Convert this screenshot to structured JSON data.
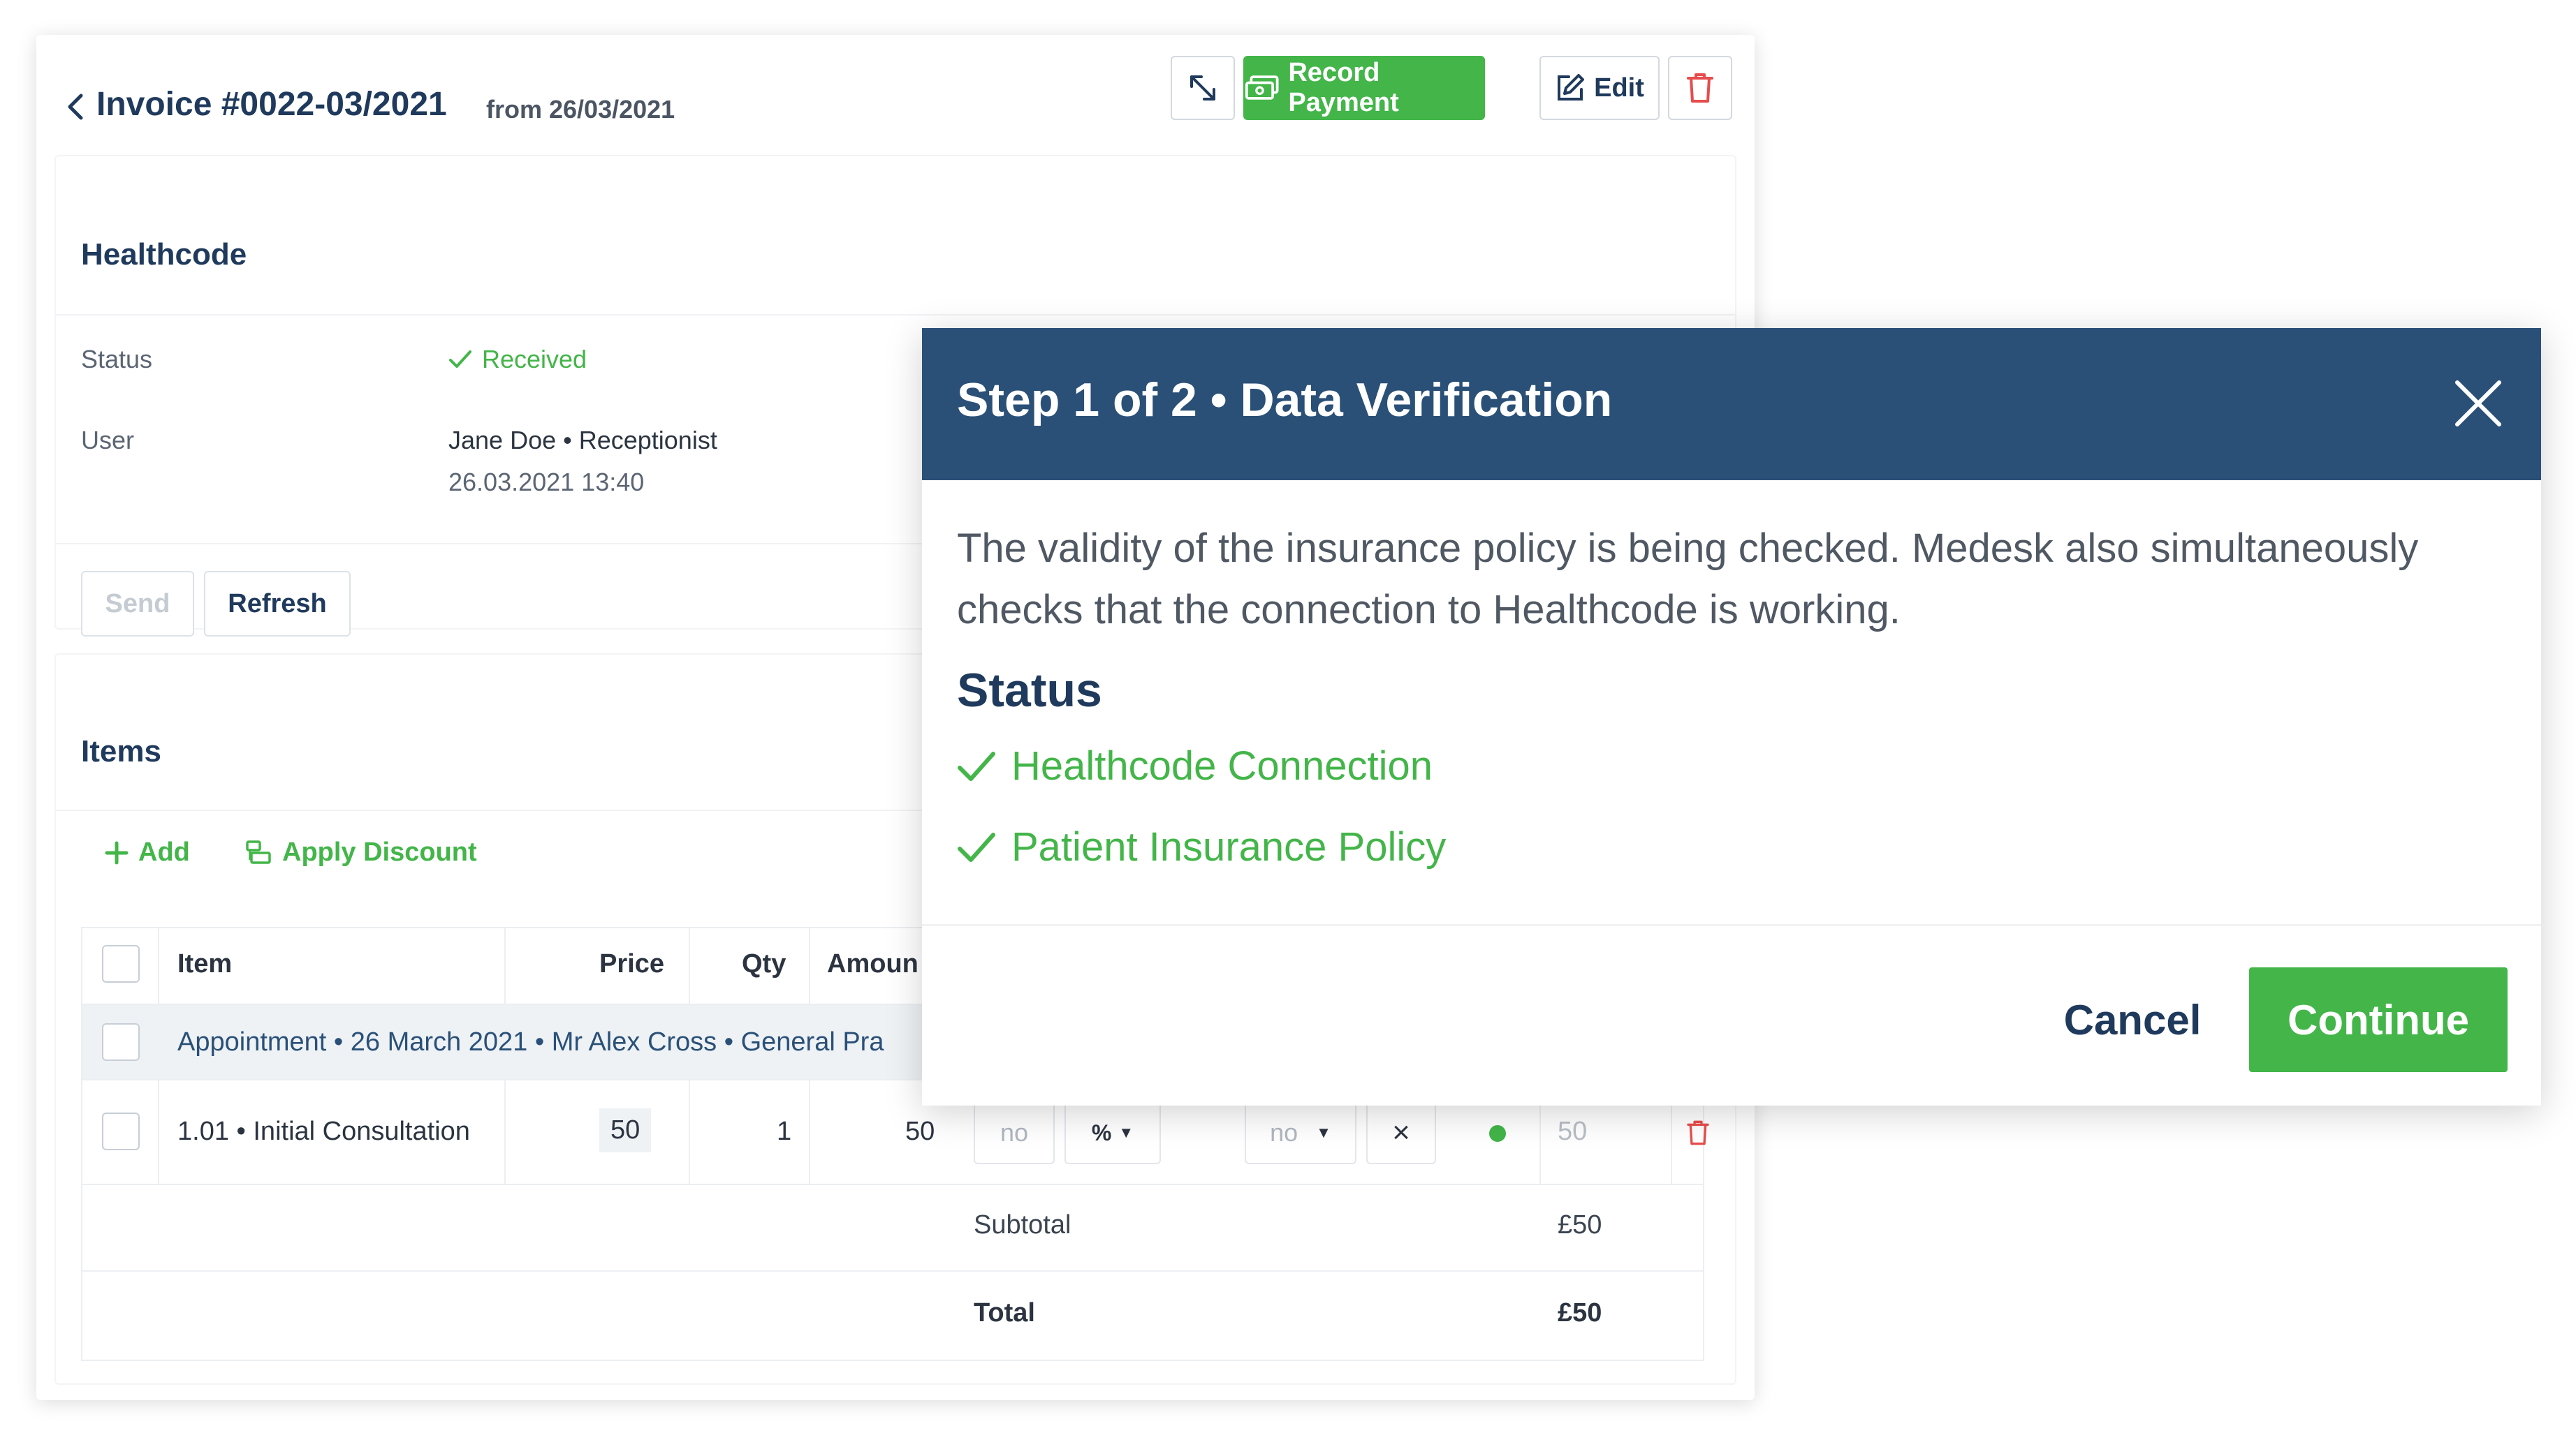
{
  "invoice": {
    "title": "Invoice #0022-03/2021",
    "date": "from 26/03/2021",
    "toolbar": {
      "expand_icon": "expand-arrows-icon",
      "record_payment_label": "Record Payment",
      "edit_label": "Edit",
      "delete_icon": "trash-icon"
    },
    "colors": {
      "accent": "#43b549",
      "navy": "#1f3a5c",
      "danger": "#e84c4c"
    }
  },
  "healthcode": {
    "title": "Healthcode",
    "status_label": "Status",
    "status_value": "Received",
    "user_label": "User",
    "user_name": "Jane Doe • Receptionist",
    "user_time": "26.03.2021 13:40",
    "send_label": "Send",
    "refresh_label": "Refresh"
  },
  "items": {
    "title": "Items",
    "add_label": "Add",
    "discount_label": "Apply Discount",
    "columns": {
      "item": "Item",
      "price": "Price",
      "qty": "Qty",
      "amount": "Amoun"
    },
    "group_row": "Appointment • 26 March 2021 • Mr Alex Cross • General Pra",
    "line": {
      "name": "1.01 • Initial Consultation",
      "price": "50",
      "qty": "1",
      "amount": "50",
      "discount_value": "no",
      "discount_unit": "%",
      "tax_value": "no",
      "clear_icon": "×",
      "final_price": "50"
    },
    "subtotal_label": "Subtotal",
    "subtotal_value": "£50",
    "total_label": "Total",
    "total_value": "£50"
  },
  "modal": {
    "title": "Step 1 of 2 • Data Verification",
    "description": "The validity of the insurance policy is being checked. Medesk also simultaneously checks that the connection to Healthcode is working.",
    "status_heading": "Status",
    "checks": [
      "Healthcode Connection",
      "Patient Insurance Policy"
    ],
    "cancel_label": "Cancel",
    "continue_label": "Continue",
    "header_color": "#2a5078"
  }
}
